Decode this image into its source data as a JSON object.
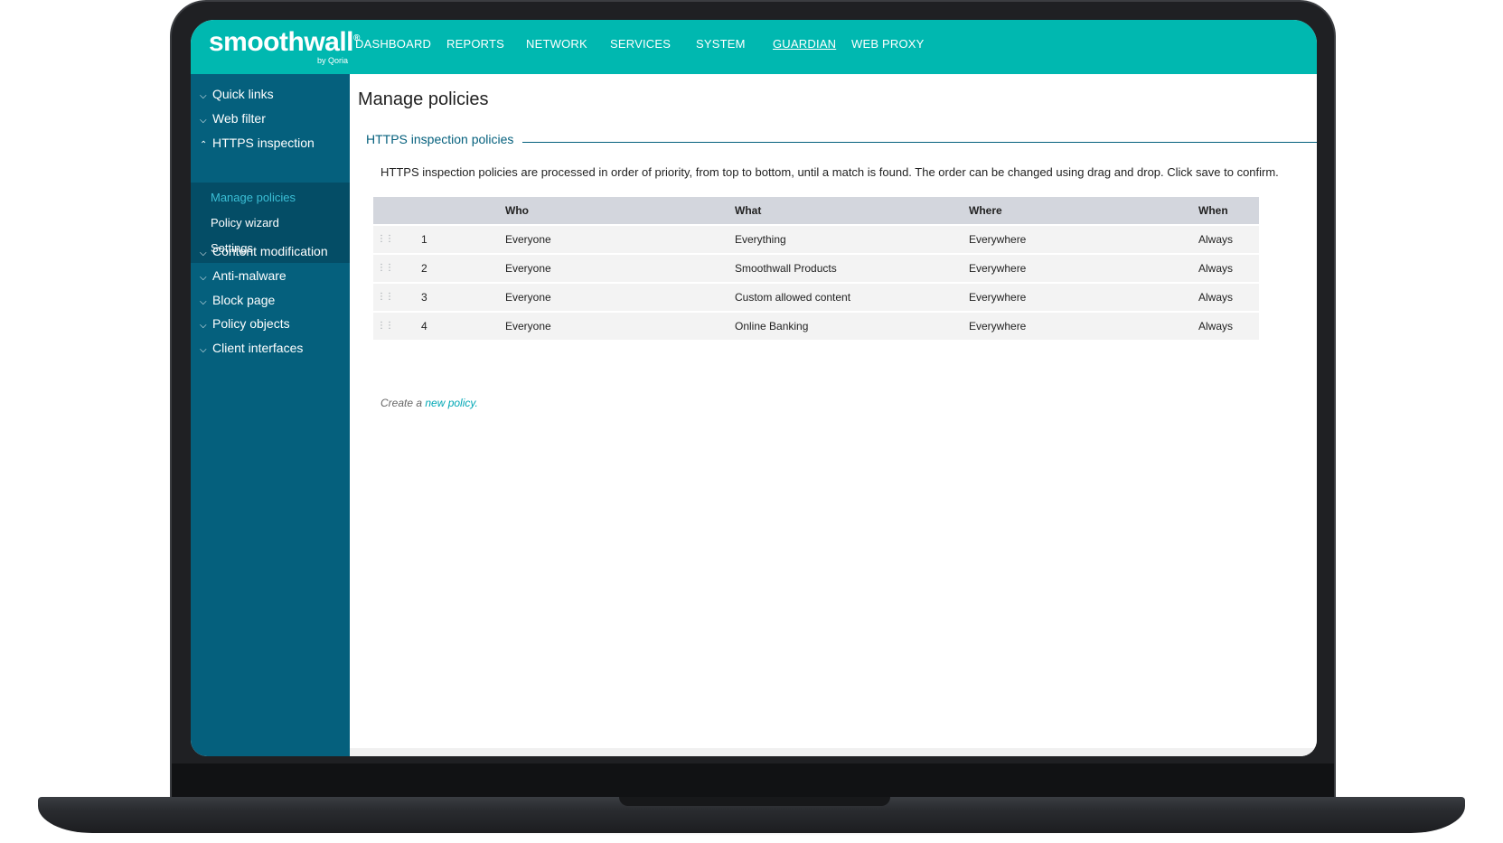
{
  "brand": {
    "name": "smoothwall",
    "registered": "®",
    "byline": "by Qoria"
  },
  "colors": {
    "topbar": "#00b8b0",
    "sidebar": "#05607d",
    "sidebar_sub": "#044d66",
    "accent_link": "#00a7b5"
  },
  "nav": {
    "items": [
      {
        "label": "DASHBOARD"
      },
      {
        "label": "REPORTS"
      },
      {
        "label": "NETWORK"
      },
      {
        "label": "SERVICES"
      },
      {
        "label": "SYSTEM"
      },
      {
        "label": "GUARDIAN",
        "active": true
      },
      {
        "label": "WEB PROXY"
      }
    ]
  },
  "sidebar": {
    "items": [
      {
        "label": "Quick links",
        "icon": "chevron-down-icon"
      },
      {
        "label": "Web filter",
        "icon": "chevron-down-icon"
      },
      {
        "label": "HTTPS inspection",
        "icon": "chevron-up-icon",
        "expanded": true
      },
      {
        "label": "Content modification",
        "icon": "chevron-down-icon"
      },
      {
        "label": "Anti-malware",
        "icon": "chevron-down-icon"
      },
      {
        "label": "Block page",
        "icon": "chevron-down-icon"
      },
      {
        "label": "Policy objects",
        "icon": "chevron-down-icon"
      },
      {
        "label": "Client interfaces",
        "icon": "chevron-down-icon"
      }
    ],
    "sub_items": [
      {
        "label": "Manage policies",
        "active": true
      },
      {
        "label": "Policy wizard"
      },
      {
        "label": "Settings"
      }
    ]
  },
  "main": {
    "title": "Manage policies",
    "section_title": "HTTPS inspection policies",
    "description": "HTTPS inspection policies are processed in order of priority, from top to bottom, until a match is found. The order can be changed using drag and drop. Click save to confirm.",
    "table": {
      "headers": [
        "",
        "Who",
        "What",
        "Where",
        "When"
      ],
      "rows": [
        {
          "num": "1",
          "who": "Everyone",
          "what": "Everything",
          "where": "Everywhere",
          "when": "Always"
        },
        {
          "num": "2",
          "who": "Everyone",
          "what": "Smoothwall Products",
          "where": "Everywhere",
          "when": "Always"
        },
        {
          "num": "3",
          "who": "Everyone",
          "what": "Custom allowed content",
          "where": "Everywhere",
          "when": "Always"
        },
        {
          "num": "4",
          "who": "Everyone",
          "what": "Online Banking",
          "where": "Everywhere",
          "when": "Always"
        }
      ]
    },
    "create_prefix": "Create a ",
    "create_link": "new policy."
  }
}
